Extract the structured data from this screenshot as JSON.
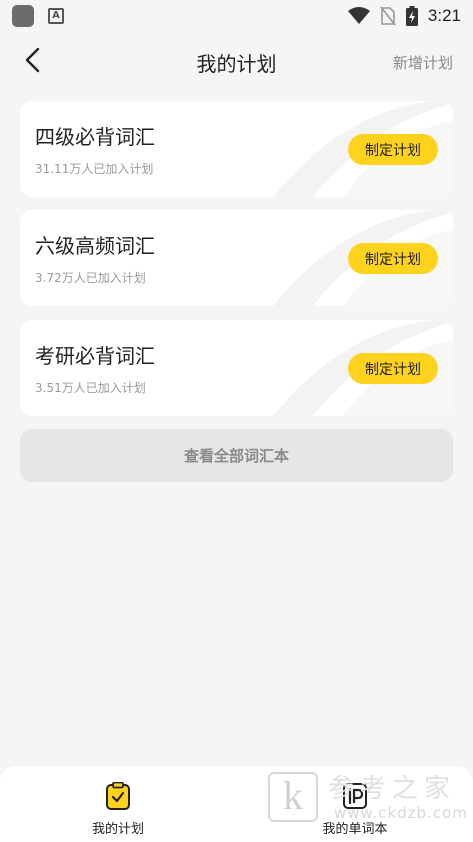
{
  "status_bar": {
    "time": "3:21",
    "icons": [
      "app-icon",
      "a-notification-icon",
      "wifi-icon",
      "no-sim-icon",
      "battery-charging-icon"
    ]
  },
  "header": {
    "back_icon": "chevron-left-icon",
    "title": "我的计划",
    "action_label": "新增计划"
  },
  "plans": [
    {
      "title": "四级必背词汇",
      "subtitle": "31.11万人已加入计划",
      "button_label": "制定计划"
    },
    {
      "title": "六级高频词汇",
      "subtitle": "3.72万人已加入计划",
      "button_label": "制定计划"
    },
    {
      "title": "考研必背词汇",
      "subtitle": "3.51万人已加入计划",
      "button_label": "制定计划"
    }
  ],
  "view_all_label": "查看全部词汇本",
  "bottom_nav": {
    "items": [
      {
        "label": "我的计划",
        "icon": "clipboard-check-icon",
        "active": true
      },
      {
        "label": "我的单词本",
        "icon": "notebook-icon",
        "active": false
      }
    ]
  },
  "watermark": {
    "logo_letter": "k",
    "brand": "参考之家",
    "url": "www.ckdzb.com"
  },
  "colors": {
    "accent": "#ffd21e",
    "background": "#f5f5f5",
    "card": "#ffffff",
    "muted_text": "#9a9a9a"
  }
}
